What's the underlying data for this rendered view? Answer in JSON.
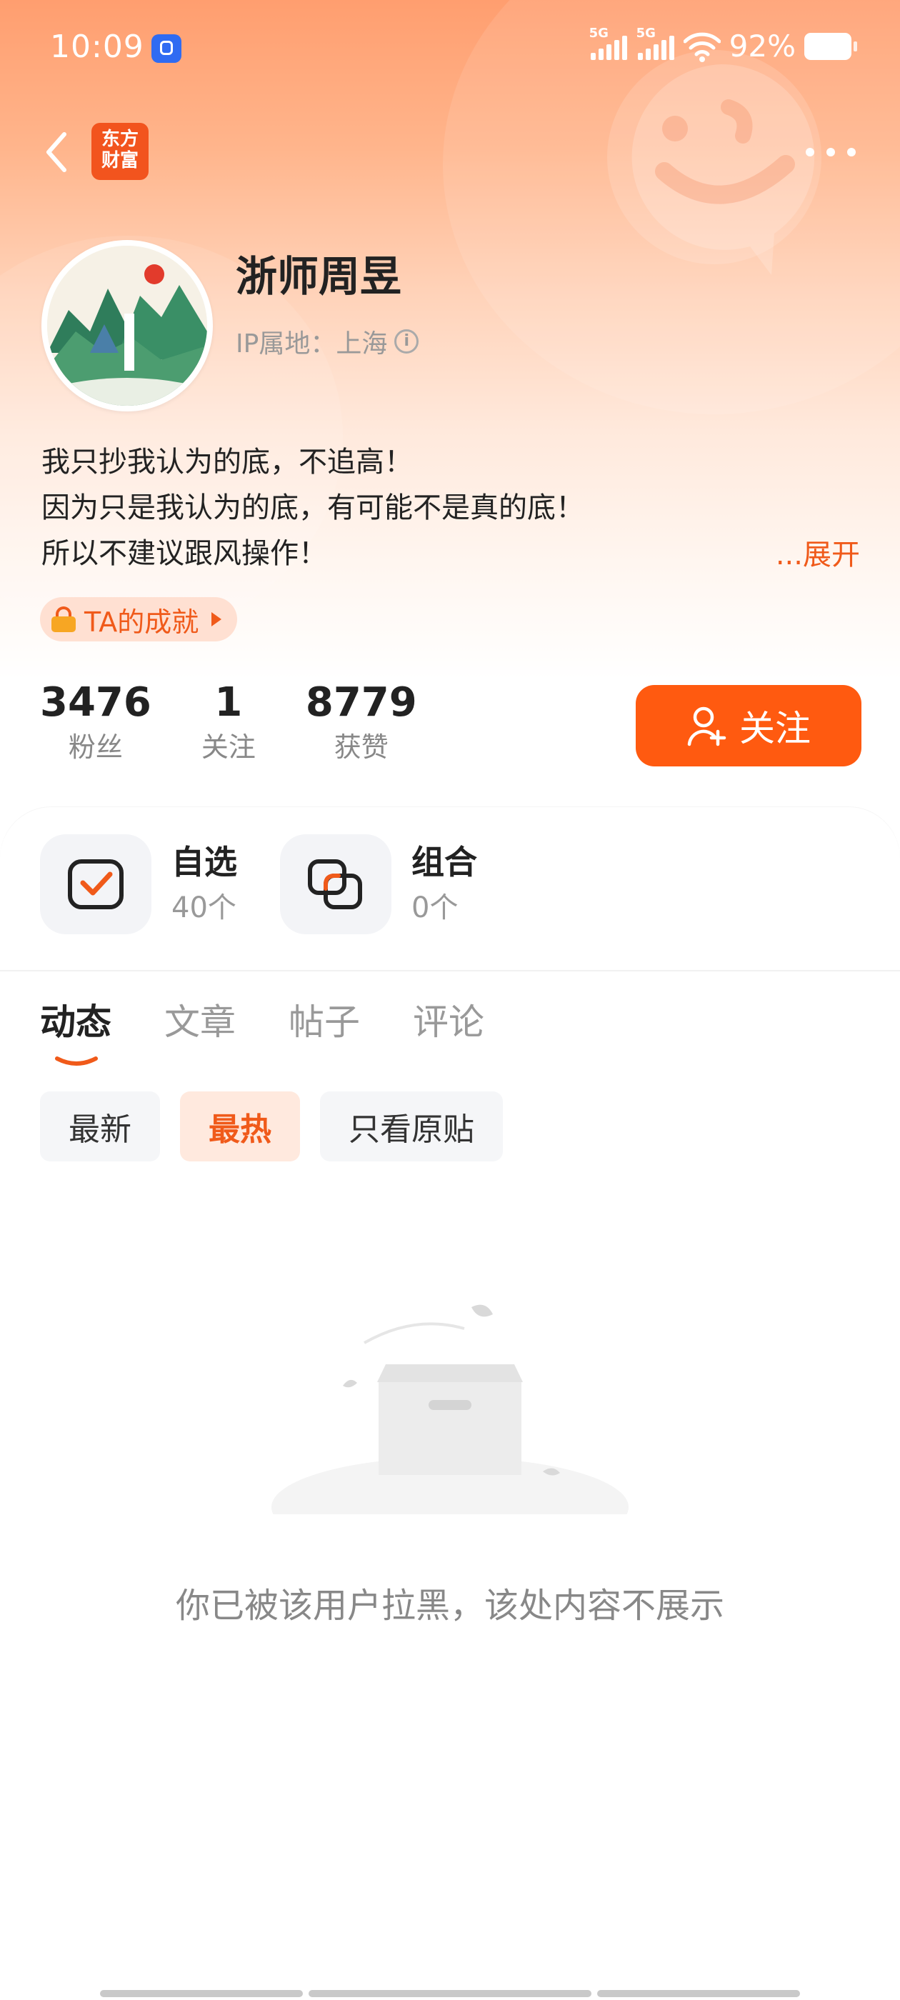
{
  "status_bar": {
    "time": "10:09",
    "signal1_label": "5G",
    "signal2_label": "5G",
    "battery_percent": "92%"
  },
  "header": {
    "logo_text_line1": "东方",
    "logo_text_line2": "财富",
    "accent_color": "#ff5a10"
  },
  "profile": {
    "username": "浙师周昱",
    "ip_location": "IP属地：上海",
    "info_glyph": "i",
    "bio_lines": [
      "我只抄我认为的底，不追高！",
      "因为只是我认为的底，有可能不是真的底！",
      "所以不建议跟风操作！"
    ],
    "expand_label": "...展开",
    "achievement_label": "TA的成就"
  },
  "stats": [
    {
      "value": "3476",
      "label": "粉丝"
    },
    {
      "value": "1",
      "label": "关注"
    },
    {
      "value": "8779",
      "label": "获赞"
    }
  ],
  "follow_button": {
    "label": "关注"
  },
  "features": {
    "watchlist": {
      "title": "自选",
      "count": "40个"
    },
    "portfolio": {
      "title": "组合",
      "count": "0个"
    }
  },
  "tabs": [
    {
      "label": "动态",
      "active": true
    },
    {
      "label": "文章",
      "active": false
    },
    {
      "label": "帖子",
      "active": false
    },
    {
      "label": "评论",
      "active": false
    }
  ],
  "filters": [
    {
      "label": "最新",
      "active": false
    },
    {
      "label": "最热",
      "active": true
    },
    {
      "label": "只看原贴",
      "active": false
    }
  ],
  "empty_state": {
    "message": "你已被该用户拉黑，该处内容不展示"
  }
}
